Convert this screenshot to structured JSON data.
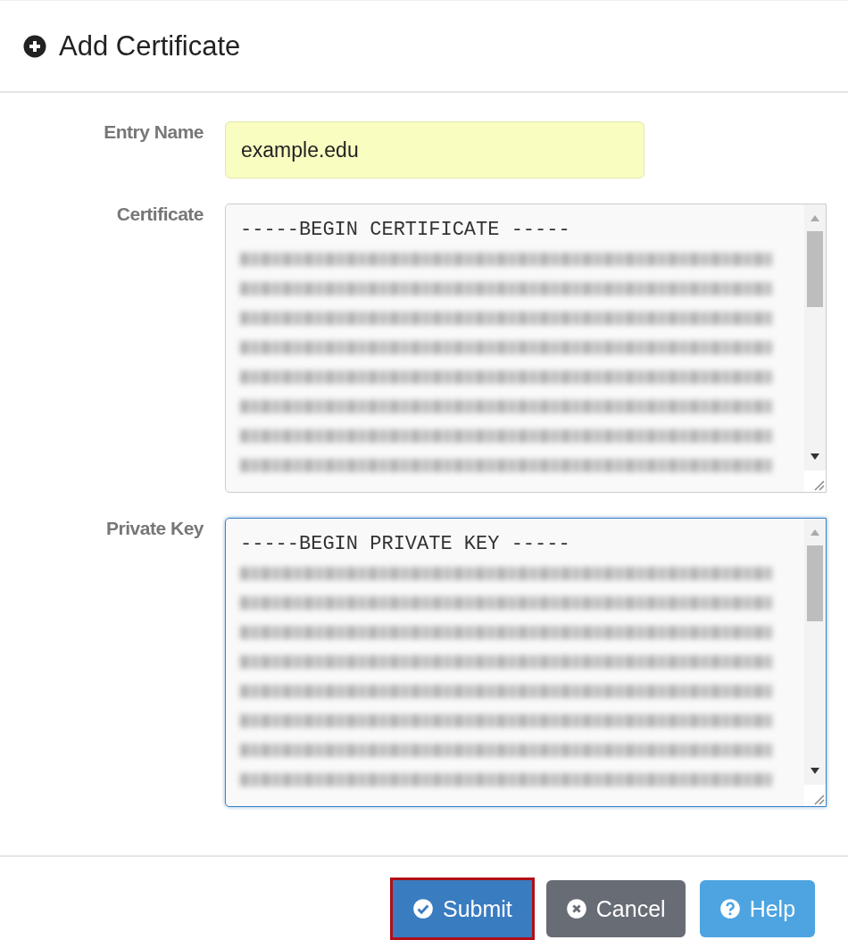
{
  "header": {
    "title": "Add Certificate"
  },
  "fields": [
    {
      "kind": "input",
      "label": "Entry Name",
      "value": "example.edu",
      "focused": false,
      "highlighted": true
    },
    {
      "kind": "textarea",
      "label": "Certificate",
      "value": "-----BEGIN CERTIFICATE -----",
      "focused": false,
      "highlighted": false
    },
    {
      "kind": "textarea",
      "label": "Private Key",
      "value": "-----BEGIN PRIVATE KEY -----",
      "focused": true,
      "highlighted": false
    }
  ],
  "buttons": [
    {
      "kind": "primary",
      "label": "Submit",
      "focused": true
    },
    {
      "kind": "secondary",
      "label": "Cancel",
      "focused": false
    },
    {
      "kind": "info",
      "label": "Help",
      "focused": false
    }
  ]
}
